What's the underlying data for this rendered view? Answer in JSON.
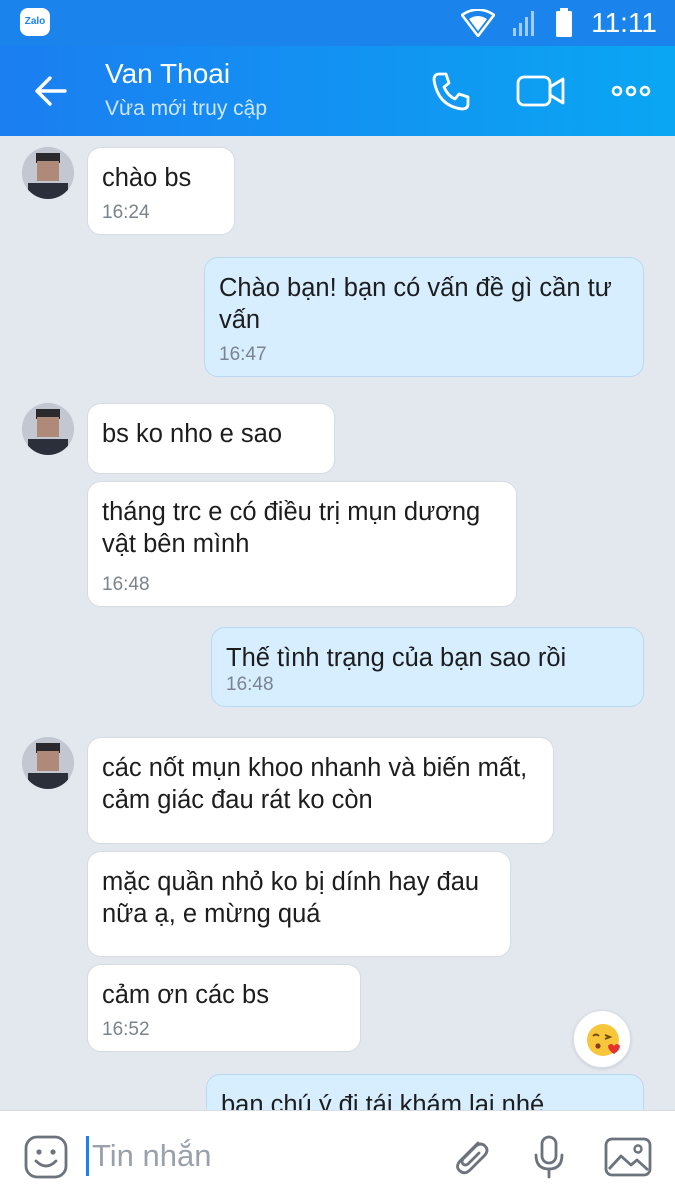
{
  "app": {
    "name": "Zalo",
    "badge": "Zalo",
    "accent": "#1a83ec"
  },
  "status_bar": {
    "time": "11:11"
  },
  "header": {
    "contact_name": "Van Thoai",
    "contact_status": "Vừa mới truy cập",
    "icons": [
      "back-arrow-icon",
      "phone-icon",
      "video-call-icon",
      "more-icon"
    ]
  },
  "messages": [
    {
      "dir": "in",
      "text": "chào bs",
      "time": "16:24"
    },
    {
      "dir": "out",
      "text": "Chào bạn! bạn có vấn đề gì cần tư vấn",
      "time": "16:47"
    },
    {
      "dir": "in",
      "text": "bs ko nho e sao",
      "time": ""
    },
    {
      "dir": "in",
      "text": "tháng trc e có điều trị mụn dương vật bên mình",
      "time": "16:48"
    },
    {
      "dir": "out",
      "text": "Thế tình trạng của bạn sao rồi",
      "time": "16:48"
    },
    {
      "dir": "in",
      "text": "các nốt mụn khoo nhanh và biến mất, cảm giác đau rát ko còn",
      "time": ""
    },
    {
      "dir": "in",
      "text": "mặc quần nhỏ ko bị dính hay đau nữa ạ, e mừng quá",
      "time": ""
    },
    {
      "dir": "in",
      "text": "cảm ơn các bs",
      "time": "16:52"
    },
    {
      "dir": "out",
      "text": "bạn chú ý đi tái khám lại nhé",
      "time": ""
    }
  ],
  "composer": {
    "placeholder": "Tin nhắn"
  }
}
